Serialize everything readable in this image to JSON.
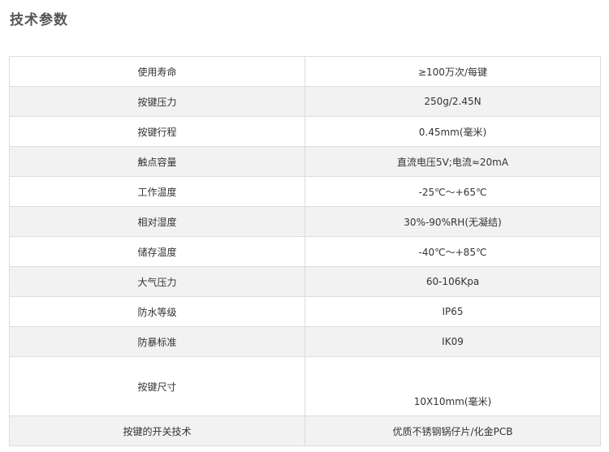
{
  "title": "技术参数",
  "rows": [
    {
      "label": "使用寿命",
      "value": "≥100万次/每键"
    },
    {
      "label": "按键压力",
      "value": "250g/2.45N"
    },
    {
      "label": "按键行程",
      "value": "0.45mm(毫米)"
    },
    {
      "label": "触点容量",
      "value": "直流电压5V;电流≈20mA"
    },
    {
      "label": "工作温度",
      "value": "-25℃～+65℃"
    },
    {
      "label": "相对湿度",
      "value": "30%-90%RH(无凝结)"
    },
    {
      "label": "储存温度",
      "value": "-40℃～+85℃"
    },
    {
      "label": "大气压力",
      "value": "60-106Kpa"
    },
    {
      "label": "防水等级",
      "value": "IP65"
    },
    {
      "label": "防暴标准",
      "value": "IK09"
    },
    {
      "label": "按键尺寸",
      "value": "10X10mm(毫米)"
    },
    {
      "label": "按键的开关技术",
      "value": "优质不锈钢锅仔片/化金PCB"
    }
  ]
}
